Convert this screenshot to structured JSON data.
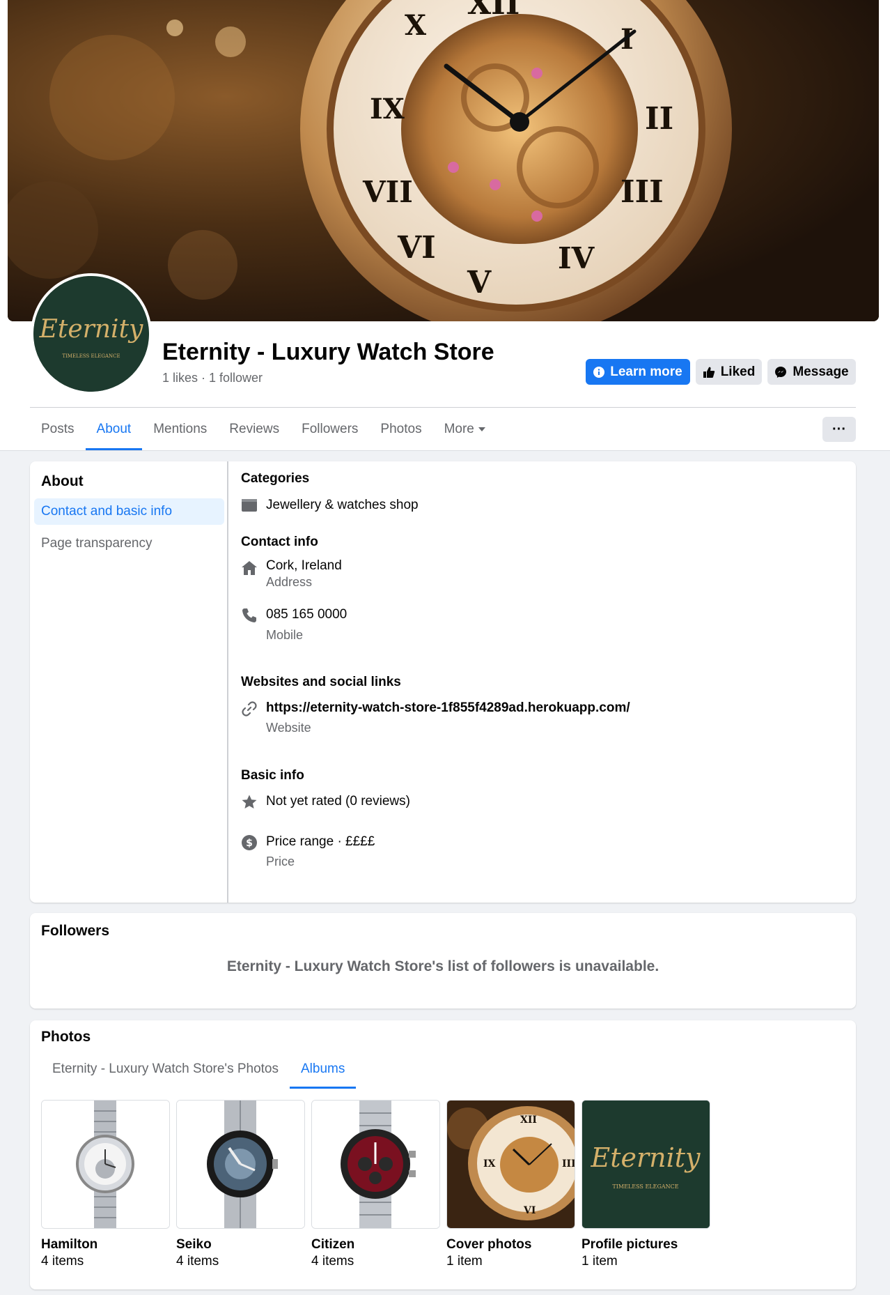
{
  "page": {
    "name": "Eternity - Luxury Watch Store",
    "stats": "1 likes · 1 follower",
    "logo_text": "Eternity",
    "logo_tagline": "TIMELESS   ELEGANCE"
  },
  "actions": {
    "learn_more": "Learn more",
    "liked": "Liked",
    "message": "Message",
    "more_dots": "···"
  },
  "tabs": [
    {
      "label": "Posts"
    },
    {
      "label": "About",
      "active": true
    },
    {
      "label": "Mentions"
    },
    {
      "label": "Reviews"
    },
    {
      "label": "Followers"
    },
    {
      "label": "Photos"
    },
    {
      "label": "More"
    }
  ],
  "about": {
    "title": "About",
    "side_items": [
      {
        "label": "Contact and basic info",
        "active": true
      },
      {
        "label": "Page transparency"
      }
    ],
    "categories": {
      "title": "Categories",
      "value": "Jewellery & watches shop",
      "icon": "category-icon"
    },
    "contact": {
      "title": "Contact info",
      "address": "Cork, Ireland",
      "address_label": "Address",
      "phone": "085 165 0000",
      "phone_label": "Mobile"
    },
    "websites": {
      "title": "Websites and social links",
      "url": "https://eternity-watch-store-1f855f4289ad.herokuapp.com/",
      "url_label": "Website"
    },
    "basic": {
      "title": "Basic info",
      "rating": "Not yet rated (0 reviews)",
      "price": "Price range · ££££",
      "price_label": "Price"
    }
  },
  "followers": {
    "title": "Followers",
    "message": "Eternity - Luxury Watch Store's list of followers is unavailable."
  },
  "photos": {
    "title": "Photos",
    "tabs": [
      {
        "label": "Eternity - Luxury Watch Store's Photos"
      },
      {
        "label": "Albums",
        "active": true
      }
    ],
    "albums": [
      {
        "name": "Hamilton",
        "count": "4 items"
      },
      {
        "name": "Seiko",
        "count": "4 items"
      },
      {
        "name": "Citizen",
        "count": "4 items"
      },
      {
        "name": "Cover photos",
        "count": "1 item"
      },
      {
        "name": "Profile pictures",
        "count": "1 item"
      }
    ]
  },
  "colors": {
    "accent": "#1877f2",
    "logo_green": "#1d3a2e",
    "gold": "#d4b06a"
  }
}
